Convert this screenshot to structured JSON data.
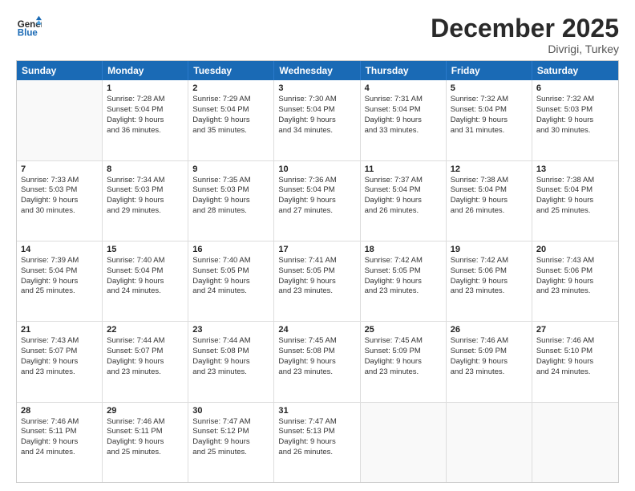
{
  "header": {
    "logo_general": "General",
    "logo_blue": "Blue",
    "month_title": "December 2025",
    "location": "Divrigi, Turkey"
  },
  "days_of_week": [
    "Sunday",
    "Monday",
    "Tuesday",
    "Wednesday",
    "Thursday",
    "Friday",
    "Saturday"
  ],
  "weeks": [
    [
      {
        "day": "",
        "lines": []
      },
      {
        "day": "1",
        "lines": [
          "Sunrise: 7:28 AM",
          "Sunset: 5:04 PM",
          "Daylight: 9 hours",
          "and 36 minutes."
        ]
      },
      {
        "day": "2",
        "lines": [
          "Sunrise: 7:29 AM",
          "Sunset: 5:04 PM",
          "Daylight: 9 hours",
          "and 35 minutes."
        ]
      },
      {
        "day": "3",
        "lines": [
          "Sunrise: 7:30 AM",
          "Sunset: 5:04 PM",
          "Daylight: 9 hours",
          "and 34 minutes."
        ]
      },
      {
        "day": "4",
        "lines": [
          "Sunrise: 7:31 AM",
          "Sunset: 5:04 PM",
          "Daylight: 9 hours",
          "and 33 minutes."
        ]
      },
      {
        "day": "5",
        "lines": [
          "Sunrise: 7:32 AM",
          "Sunset: 5:04 PM",
          "Daylight: 9 hours",
          "and 31 minutes."
        ]
      },
      {
        "day": "6",
        "lines": [
          "Sunrise: 7:32 AM",
          "Sunset: 5:03 PM",
          "Daylight: 9 hours",
          "and 30 minutes."
        ]
      }
    ],
    [
      {
        "day": "7",
        "lines": [
          "Sunrise: 7:33 AM",
          "Sunset: 5:03 PM",
          "Daylight: 9 hours",
          "and 30 minutes."
        ]
      },
      {
        "day": "8",
        "lines": [
          "Sunrise: 7:34 AM",
          "Sunset: 5:03 PM",
          "Daylight: 9 hours",
          "and 29 minutes."
        ]
      },
      {
        "day": "9",
        "lines": [
          "Sunrise: 7:35 AM",
          "Sunset: 5:03 PM",
          "Daylight: 9 hours",
          "and 28 minutes."
        ]
      },
      {
        "day": "10",
        "lines": [
          "Sunrise: 7:36 AM",
          "Sunset: 5:04 PM",
          "Daylight: 9 hours",
          "and 27 minutes."
        ]
      },
      {
        "day": "11",
        "lines": [
          "Sunrise: 7:37 AM",
          "Sunset: 5:04 PM",
          "Daylight: 9 hours",
          "and 26 minutes."
        ]
      },
      {
        "day": "12",
        "lines": [
          "Sunrise: 7:38 AM",
          "Sunset: 5:04 PM",
          "Daylight: 9 hours",
          "and 26 minutes."
        ]
      },
      {
        "day": "13",
        "lines": [
          "Sunrise: 7:38 AM",
          "Sunset: 5:04 PM",
          "Daylight: 9 hours",
          "and 25 minutes."
        ]
      }
    ],
    [
      {
        "day": "14",
        "lines": [
          "Sunrise: 7:39 AM",
          "Sunset: 5:04 PM",
          "Daylight: 9 hours",
          "and 25 minutes."
        ]
      },
      {
        "day": "15",
        "lines": [
          "Sunrise: 7:40 AM",
          "Sunset: 5:04 PM",
          "Daylight: 9 hours",
          "and 24 minutes."
        ]
      },
      {
        "day": "16",
        "lines": [
          "Sunrise: 7:40 AM",
          "Sunset: 5:05 PM",
          "Daylight: 9 hours",
          "and 24 minutes."
        ]
      },
      {
        "day": "17",
        "lines": [
          "Sunrise: 7:41 AM",
          "Sunset: 5:05 PM",
          "Daylight: 9 hours",
          "and 23 minutes."
        ]
      },
      {
        "day": "18",
        "lines": [
          "Sunrise: 7:42 AM",
          "Sunset: 5:05 PM",
          "Daylight: 9 hours",
          "and 23 minutes."
        ]
      },
      {
        "day": "19",
        "lines": [
          "Sunrise: 7:42 AM",
          "Sunset: 5:06 PM",
          "Daylight: 9 hours",
          "and 23 minutes."
        ]
      },
      {
        "day": "20",
        "lines": [
          "Sunrise: 7:43 AM",
          "Sunset: 5:06 PM",
          "Daylight: 9 hours",
          "and 23 minutes."
        ]
      }
    ],
    [
      {
        "day": "21",
        "lines": [
          "Sunrise: 7:43 AM",
          "Sunset: 5:07 PM",
          "Daylight: 9 hours",
          "and 23 minutes."
        ]
      },
      {
        "day": "22",
        "lines": [
          "Sunrise: 7:44 AM",
          "Sunset: 5:07 PM",
          "Daylight: 9 hours",
          "and 23 minutes."
        ]
      },
      {
        "day": "23",
        "lines": [
          "Sunrise: 7:44 AM",
          "Sunset: 5:08 PM",
          "Daylight: 9 hours",
          "and 23 minutes."
        ]
      },
      {
        "day": "24",
        "lines": [
          "Sunrise: 7:45 AM",
          "Sunset: 5:08 PM",
          "Daylight: 9 hours",
          "and 23 minutes."
        ]
      },
      {
        "day": "25",
        "lines": [
          "Sunrise: 7:45 AM",
          "Sunset: 5:09 PM",
          "Daylight: 9 hours",
          "and 23 minutes."
        ]
      },
      {
        "day": "26",
        "lines": [
          "Sunrise: 7:46 AM",
          "Sunset: 5:09 PM",
          "Daylight: 9 hours",
          "and 23 minutes."
        ]
      },
      {
        "day": "27",
        "lines": [
          "Sunrise: 7:46 AM",
          "Sunset: 5:10 PM",
          "Daylight: 9 hours",
          "and 24 minutes."
        ]
      }
    ],
    [
      {
        "day": "28",
        "lines": [
          "Sunrise: 7:46 AM",
          "Sunset: 5:11 PM",
          "Daylight: 9 hours",
          "and 24 minutes."
        ]
      },
      {
        "day": "29",
        "lines": [
          "Sunrise: 7:46 AM",
          "Sunset: 5:11 PM",
          "Daylight: 9 hours",
          "and 25 minutes."
        ]
      },
      {
        "day": "30",
        "lines": [
          "Sunrise: 7:47 AM",
          "Sunset: 5:12 PM",
          "Daylight: 9 hours",
          "and 25 minutes."
        ]
      },
      {
        "day": "31",
        "lines": [
          "Sunrise: 7:47 AM",
          "Sunset: 5:13 PM",
          "Daylight: 9 hours",
          "and 26 minutes."
        ]
      },
      {
        "day": "",
        "lines": []
      },
      {
        "day": "",
        "lines": []
      },
      {
        "day": "",
        "lines": []
      }
    ]
  ]
}
